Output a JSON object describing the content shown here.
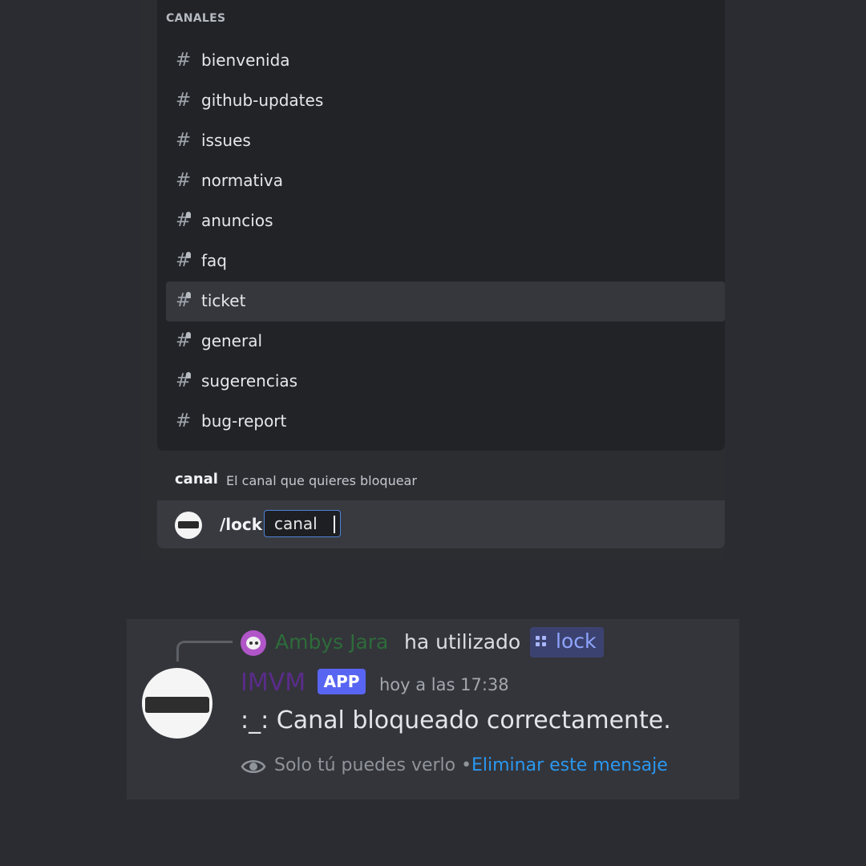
{
  "autocomplete": {
    "section_header": "CANALES",
    "channels": [
      {
        "name": "bienvenida",
        "locked": false,
        "selected": false
      },
      {
        "name": "github-updates",
        "locked": false,
        "selected": false
      },
      {
        "name": "issues",
        "locked": false,
        "selected": false
      },
      {
        "name": "normativa",
        "locked": false,
        "selected": false
      },
      {
        "name": "anuncios",
        "locked": true,
        "selected": false
      },
      {
        "name": "faq",
        "locked": true,
        "selected": false
      },
      {
        "name": "ticket",
        "locked": true,
        "selected": true
      },
      {
        "name": "general",
        "locked": true,
        "selected": false
      },
      {
        "name": "sugerencias",
        "locked": true,
        "selected": false
      },
      {
        "name": "bug-report",
        "locked": false,
        "selected": false
      }
    ]
  },
  "option_hint": {
    "name": "canal",
    "description": "El canal que quieres bloquear"
  },
  "command_input": {
    "command": "/lock",
    "param": "canal"
  },
  "message": {
    "reply": {
      "user": "Ambys Jara",
      "action": "ha utilizado",
      "command": "lock"
    },
    "author": "IMVM",
    "badge": "APP",
    "timestamp": "hoy a las 17:38",
    "content": ":_: Canal bloqueado correctamente.",
    "ephemeral_note": "Solo tú puedes verlo •",
    "delete_link": "Eliminar este mensaje"
  },
  "colors": {
    "background": "#2b2c31",
    "accent": "#5865f2",
    "link": "#2a98f0",
    "reply_user": "#2e6b3a",
    "author": "#5a2c8a"
  },
  "icons": {
    "channel": "hash-icon",
    "locked_channel": "locked-hash-icon",
    "command_chip": "slash-command-icon",
    "ephemeral": "eye-icon"
  }
}
